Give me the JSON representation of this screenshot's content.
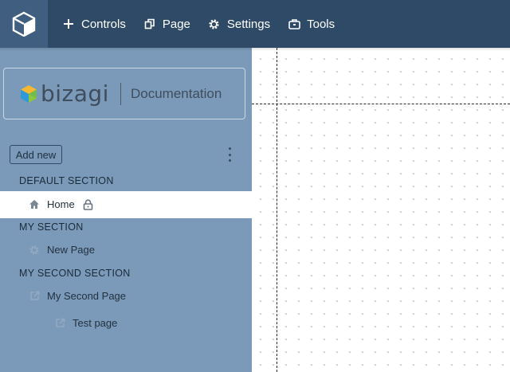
{
  "topbar": {
    "menu": [
      {
        "label": "Controls",
        "icon": "plus-icon"
      },
      {
        "label": "Page",
        "icon": "page-copy-icon"
      },
      {
        "label": "Settings",
        "icon": "gear-icon"
      },
      {
        "label": "Tools",
        "icon": "toolbox-icon"
      }
    ]
  },
  "sidebar": {
    "brand_name": "bizagi",
    "brand_product": "Documentation",
    "add_new_label": "Add new",
    "sections": [
      {
        "title": "DEFAULT SECTION",
        "pages": [
          {
            "label": "Home",
            "icon": "home-icon",
            "locked": true,
            "selected": true
          }
        ]
      },
      {
        "title": "MY SECTION",
        "pages": [
          {
            "label": "New Page",
            "icon": "gear-icon"
          }
        ]
      },
      {
        "title": "MY SECOND SECTION",
        "pages": [
          {
            "label": "My Second Page",
            "icon": "external-link-icon"
          },
          {
            "label": "Test page",
            "icon": "external-link-icon",
            "indent": 2
          }
        ]
      }
    ]
  },
  "colors": {
    "topbar": "#2f4a66",
    "sidebar": "#7b9ab9",
    "selected_row": "#ffffff"
  }
}
